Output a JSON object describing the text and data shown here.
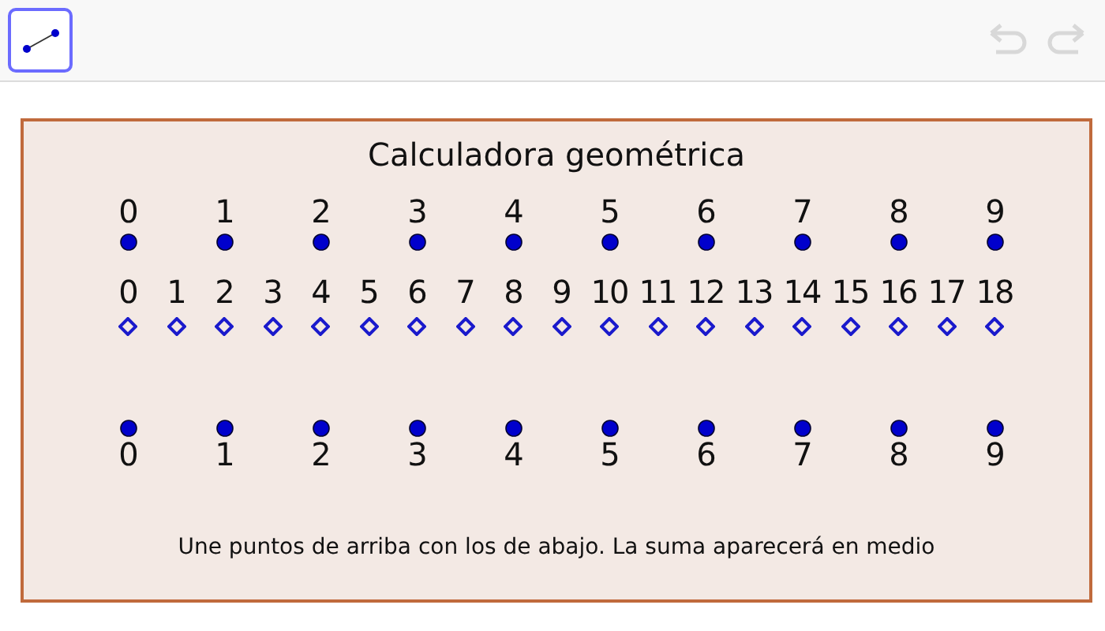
{
  "toolbar": {
    "tools": [
      {
        "kind": "segment",
        "selected": true
      }
    ],
    "undo": {
      "disabled": true
    },
    "redo": {
      "disabled": true
    }
  },
  "canvas": {
    "title": "Calculadora geométrica",
    "top_points": [
      "0",
      "1",
      "2",
      "3",
      "4",
      "5",
      "6",
      "7",
      "8",
      "9"
    ],
    "sum_points": [
      "0",
      "1",
      "2",
      "3",
      "4",
      "5",
      "6",
      "7",
      "8",
      "9",
      "10",
      "11",
      "12",
      "13",
      "14",
      "15",
      "16",
      "17",
      "18"
    ],
    "bottom_points": [
      "0",
      "1",
      "2",
      "3",
      "4",
      "5",
      "6",
      "7",
      "8",
      "9"
    ],
    "caption": "Une puntos de arriba con los de abajo. La suma aparecerá en medio"
  }
}
